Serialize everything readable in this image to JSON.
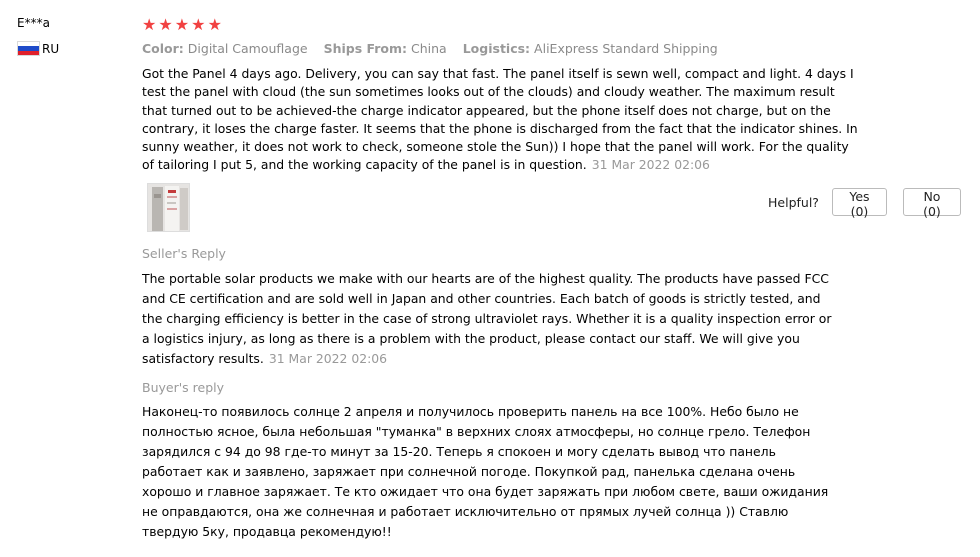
{
  "user": {
    "name": "E***a",
    "country": "RU",
    "flag_colors": [
      "#ffffff",
      "#1e4bc9",
      "#e0202b"
    ]
  },
  "review": {
    "stars": 5,
    "star_color": "#f14141",
    "meta": {
      "color_label": "Color:",
      "color_value": "Digital Camouflage",
      "ships_label": "Ships From:",
      "ships_value": "China",
      "logistics_label": "Logistics:",
      "logistics_value": "AliExpress Standard Shipping"
    },
    "text": "Got the Panel 4 days ago. Delivery, you can say that fast. The panel itself is sewn well, compact and light. 4 days I test the panel with cloud (the sun sometimes looks out of the clouds) and cloudy weather. The maximum result that turned out to be achieved-the charge indicator appeared, but the phone itself does not charge, but on the contrary, it loses the charge faster. It seems that the phone is discharged from the fact that the indicator shines. In sunny weather, it does not work to check, someone stole the Sun)) I hope that the panel will work. For the quality of tailoring I put 5, and the working capacity of the panel is in question.",
    "time": "31 Mar 2022 02:06"
  },
  "helpful": {
    "label": "Helpful?",
    "yes_label": "Yes (0)",
    "no_label": "No (0)"
  },
  "seller_reply": {
    "title": "Seller's Reply",
    "text": "The portable solar products we make with our hearts are of the highest quality. The products have passed FCC and CE certification and are sold well in Japan and other countries. Each batch of goods is strictly tested, and the charging efficiency is better in the case of strong ultraviolet rays. Whether it is a quality inspection error or a logistics injury, as long as there is a problem with the product, please contact our staff. We will give you satisfactory results.",
    "time": "31 Mar 2022 02:06"
  },
  "buyer_reply": {
    "title": "Buyer's reply",
    "text": "Наконец-то появилось солнце 2 апреля и получилось проверить панель на все 100%. Небо было не полностью ясное, была небольшая \"туманка\" в верхних слоях атмосферы, но солнце грело. Телефон зарядился с 94 до 98 где-то минут за 15-20. Теперь я спокоен и могу сделать вывод что панель работает как и заявлено, заряжает при солнечной погоде. Покупкой рад, панелька сделана очень хорошо и главное заряжает. Те кто ожидает что она будет заряжать при любом свете, ваши ожидания не оправдаются, она же солнечная и работает исключительно от прямых лучей солнца )) Ставлю твердую 5ку, продавца рекомендую!!"
  }
}
